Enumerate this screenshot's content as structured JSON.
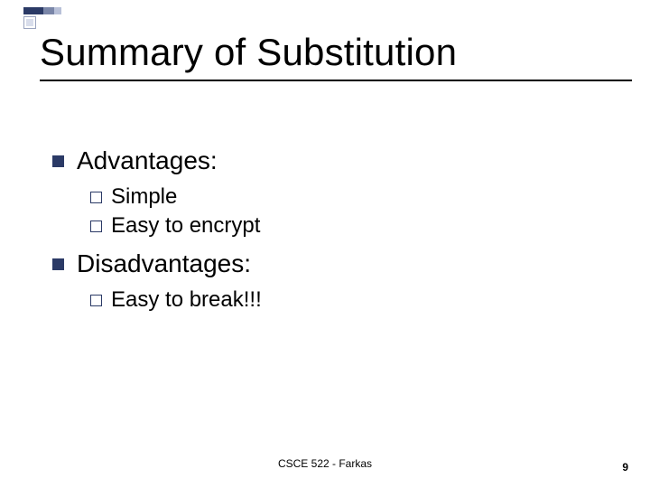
{
  "title": "Summary of Substitution",
  "bullets": {
    "advantages": {
      "label": "Advantages:",
      "items": [
        "Simple",
        "Easy to encrypt"
      ]
    },
    "disadvantages": {
      "label": "Disadvantages:",
      "items": [
        "Easy to break!!!"
      ]
    }
  },
  "footer": {
    "center": "CSCE 522 - Farkas",
    "page": "9"
  },
  "chart_data": {
    "type": "table",
    "title": "Summary of Substitution",
    "series": [
      {
        "name": "Advantages",
        "values": [
          "Simple",
          "Easy to encrypt"
        ]
      },
      {
        "name": "Disadvantages",
        "values": [
          "Easy to break!!!"
        ]
      }
    ]
  }
}
